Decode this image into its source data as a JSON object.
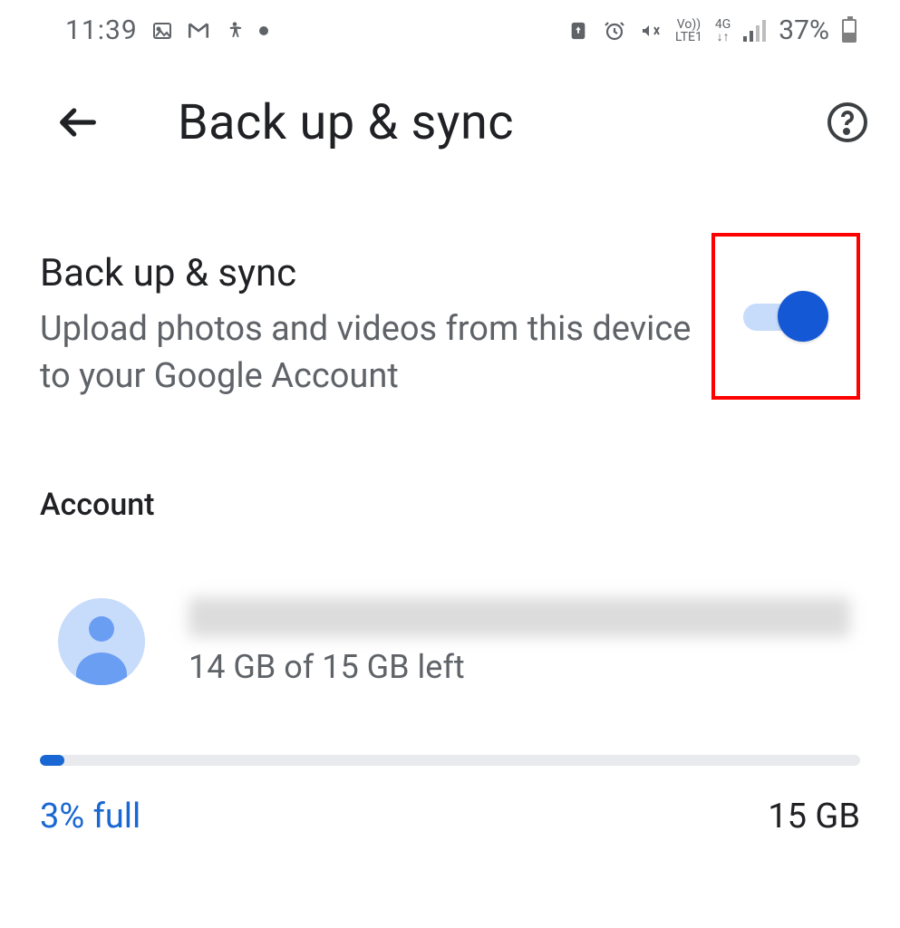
{
  "status_bar": {
    "time": "11:39",
    "battery_percent": "37%",
    "icons": {
      "volte": "Vo))",
      "lte": "LTE1",
      "net": "4G"
    }
  },
  "app_bar": {
    "title": "Back up & sync"
  },
  "backup_sync": {
    "title": "Back up & sync",
    "description": "Upload photos and videos from this device to your Google Account",
    "enabled": true
  },
  "account_section": {
    "label": "Account",
    "storage_text": "14 GB of 15 GB left"
  },
  "storage_bar": {
    "left_text": "3% full",
    "right_text": "15 GB",
    "percent_full": 3
  },
  "colors": {
    "accent": "#1558d6",
    "track": "#c7dbfb",
    "text_secondary": "#5f6368",
    "highlight_border": "#ff0000"
  }
}
